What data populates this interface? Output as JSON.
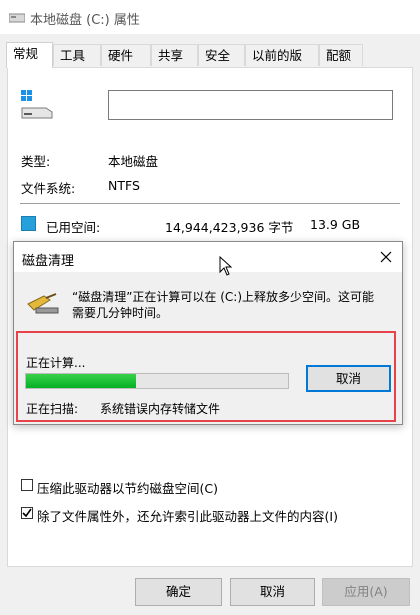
{
  "window": {
    "title": "本地磁盘 (C:) 属性"
  },
  "tabs": [
    {
      "label": "常规",
      "active": true
    },
    {
      "label": "工具"
    },
    {
      "label": "硬件"
    },
    {
      "label": "共享"
    },
    {
      "label": "安全"
    },
    {
      "label": "以前的版本"
    },
    {
      "label": "配额"
    }
  ],
  "general": {
    "type_label": "类型:",
    "type_value": "本地磁盘",
    "fs_label": "文件系统:",
    "fs_value": "NTFS",
    "used_label": "已用空间:",
    "used_bytes": "14,944,423,936 字节",
    "used_gb": "13.9 GB",
    "compress_label": "压缩此驱动器以节约磁盘空间(C)",
    "index_label": "除了文件属性外，还允许索引此驱动器上文件的内容(I)"
  },
  "dialog": {
    "title": "磁盘清理",
    "message": "“磁盘清理”正在计算可以在 (C:)上释放多少空间。这可能需要几分钟时间。",
    "calculating": "正在计算...",
    "cancel_label": "取消",
    "progress": 0.42,
    "scanning_label": "正在扫描:",
    "scanning_item": "系统错误内存转储文件"
  },
  "buttons": {
    "ok": "确定",
    "cancel": "取消",
    "apply": "应用(A)"
  },
  "colors": {
    "progress": "#06b025",
    "highlight": "#e8424a",
    "used_space": "#26a0da"
  }
}
